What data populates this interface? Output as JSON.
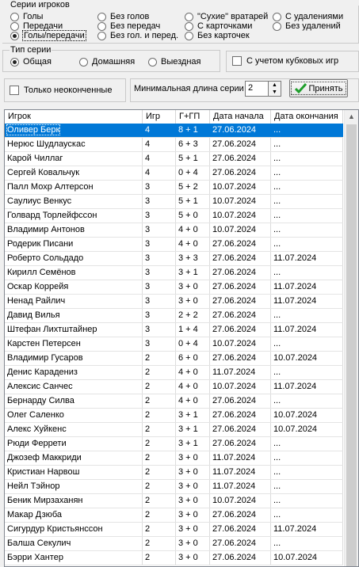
{
  "series_group": {
    "title": "Серии игроков",
    "options": [
      {
        "label": "Голы",
        "selected": false
      },
      {
        "label": "Передачи",
        "selected": false
      },
      {
        "label": "Голы/передачи",
        "selected": true
      },
      {
        "label": "Без голов",
        "selected": false
      },
      {
        "label": "Без передач",
        "selected": false
      },
      {
        "label": "Без гол. и перед.",
        "selected": false
      },
      {
        "label": "\"Сухие\" вратарей",
        "selected": false
      },
      {
        "label": "С карточками",
        "selected": false
      },
      {
        "label": "Без карточек",
        "selected": false
      },
      {
        "label": "С удалениями",
        "selected": false
      },
      {
        "label": "Без удалений",
        "selected": false
      }
    ]
  },
  "type_group": {
    "title": "Тип серии",
    "options": [
      {
        "label": "Общая",
        "selected": true
      },
      {
        "label": "Домашняя",
        "selected": false
      },
      {
        "label": "Выездная",
        "selected": false
      }
    ]
  },
  "cup_checkbox": {
    "label": "С учетом кубковых игр",
    "checked": false
  },
  "unfinished_checkbox": {
    "label": "Только неоконченные",
    "checked": false
  },
  "min_length": {
    "label": "Минимальная длина серии",
    "value": "2"
  },
  "accept_button": {
    "label": "Принять",
    "icon": "checkmark-icon",
    "icon_color": "#1f9e2c"
  },
  "table": {
    "columns": [
      "Игрок",
      "Игр",
      "Г+ГП",
      "Дата начала",
      "Дата окончания"
    ],
    "rows": [
      [
        "Оливер Берк",
        "4",
        "8 + 1",
        "27.06.2024",
        "..."
      ],
      [
        "Нерюс Шудлаускас",
        "4",
        "6 + 3",
        "27.06.2024",
        "..."
      ],
      [
        "Карой Чиллаг",
        "4",
        "5 + 1",
        "27.06.2024",
        "..."
      ],
      [
        "Сергей Ковальчук",
        "4",
        "0 + 4",
        "27.06.2024",
        "..."
      ],
      [
        "Палл Мохр Алтерсон",
        "3",
        "5 + 2",
        "10.07.2024",
        "..."
      ],
      [
        "Саулиус Венкус",
        "3",
        "5 + 1",
        "10.07.2024",
        "..."
      ],
      [
        "Голвард Торлейфссон",
        "3",
        "5 + 0",
        "10.07.2024",
        "..."
      ],
      [
        "Владимир Антонов",
        "3",
        "4 + 0",
        "10.07.2024",
        "..."
      ],
      [
        "Родерик Писани",
        "3",
        "4 + 0",
        "27.06.2024",
        "..."
      ],
      [
        "Роберто Сольдадо",
        "3",
        "3 + 3",
        "27.06.2024",
        "11.07.2024"
      ],
      [
        "Кирилл Семёнов",
        "3",
        "3 + 1",
        "27.06.2024",
        "..."
      ],
      [
        "Оскар Коррейя",
        "3",
        "3 + 0",
        "27.06.2024",
        "11.07.2024"
      ],
      [
        "Ненад Райлич",
        "3",
        "3 + 0",
        "27.06.2024",
        "11.07.2024"
      ],
      [
        "Давид Вилья",
        "3",
        "2 + 2",
        "27.06.2024",
        "..."
      ],
      [
        "Штефан Лихтштайнер",
        "3",
        "1 + 4",
        "27.06.2024",
        "11.07.2024"
      ],
      [
        "Карстен Петерсен",
        "3",
        "0 + 4",
        "10.07.2024",
        "..."
      ],
      [
        "Владимир Гусаров",
        "2",
        "6 + 0",
        "27.06.2024",
        "10.07.2024"
      ],
      [
        "Денис Карадениз",
        "2",
        "4 + 0",
        "11.07.2024",
        "..."
      ],
      [
        "Алексис Санчес",
        "2",
        "4 + 0",
        "10.07.2024",
        "11.07.2024"
      ],
      [
        "Бернарду Силва",
        "2",
        "4 + 0",
        "27.06.2024",
        "..."
      ],
      [
        "Олег Саленко",
        "2",
        "3 + 1",
        "27.06.2024",
        "10.07.2024"
      ],
      [
        "Алекс Хуйкенс",
        "2",
        "3 + 1",
        "27.06.2024",
        "10.07.2024"
      ],
      [
        "Рюди Феррети",
        "2",
        "3 + 1",
        "27.06.2024",
        "..."
      ],
      [
        "Джозеф Маккриди",
        "2",
        "3 + 0",
        "11.07.2024",
        "..."
      ],
      [
        "Кристиан Нарвош",
        "2",
        "3 + 0",
        "11.07.2024",
        "..."
      ],
      [
        "Нейл Тэйнор",
        "2",
        "3 + 0",
        "11.07.2024",
        "..."
      ],
      [
        "Беник Мирзаханян",
        "2",
        "3 + 0",
        "10.07.2024",
        "..."
      ],
      [
        "Макар Дзюба",
        "2",
        "3 + 0",
        "27.06.2024",
        "..."
      ],
      [
        "Сигурдур Кристьянссон",
        "2",
        "3 + 0",
        "27.06.2024",
        "11.07.2024"
      ],
      [
        "Балша Секулич",
        "2",
        "3 + 0",
        "27.06.2024",
        "..."
      ],
      [
        "Бэрри Хантер",
        "2",
        "3 + 0",
        "27.06.2024",
        "10.07.2024"
      ]
    ],
    "selected_row": 0
  }
}
